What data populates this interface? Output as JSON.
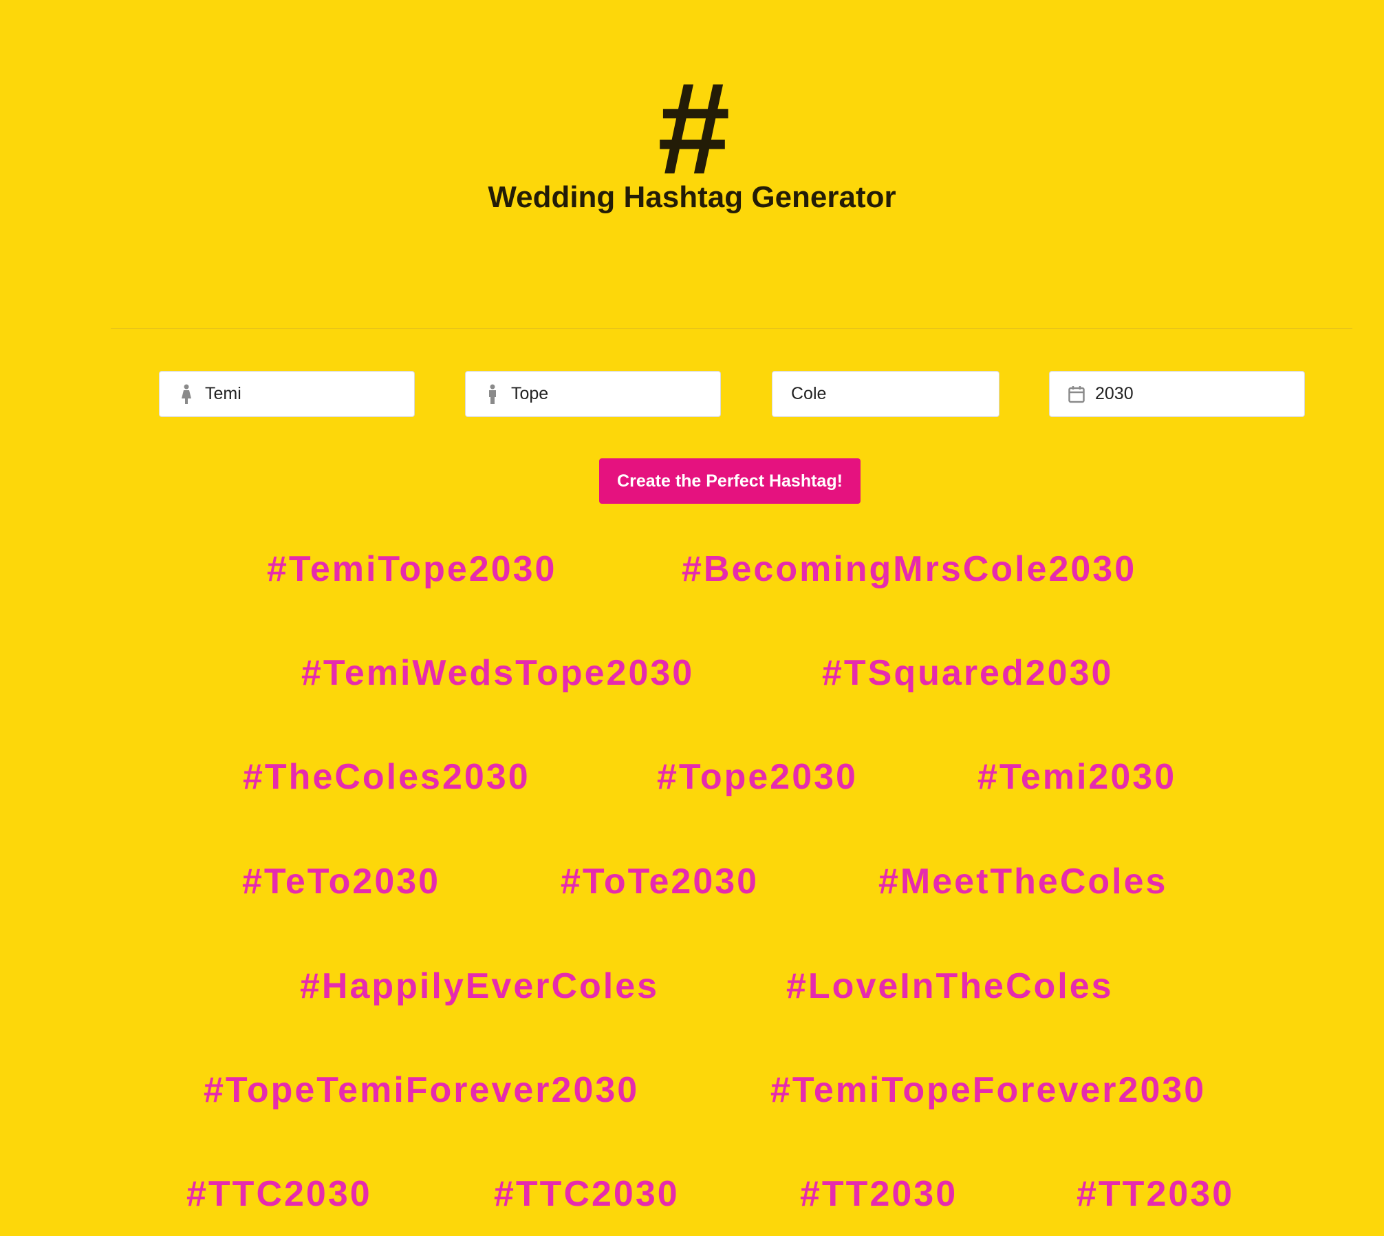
{
  "header": {
    "logo_glyph": "#",
    "title": "Wedding Hashtag Generator"
  },
  "form": {
    "first_name": {
      "value": "Temi",
      "icon": "female-person-icon"
    },
    "second_name": {
      "value": "Tope",
      "icon": "male-person-icon"
    },
    "last_name": {
      "value": "Cole"
    },
    "year": {
      "value": "2030",
      "icon": "calendar-icon"
    },
    "submit_label": "Create the Perfect Hashtag!"
  },
  "hashtags": [
    "#TemiTope2030",
    "#BecomingMrsCole2030",
    "#TemiWedsTope2030",
    "#TSquared2030",
    "#TheColes2030",
    "#Tope2030",
    "#Temi2030",
    "#TeTo2030",
    "#ToTe2030",
    "#MeetTheColes",
    "#HappilyEverColes",
    "#LoveInTheColes",
    "#TopeTemiForever2030",
    "#TemiTopeForever2030",
    "#TTC2030",
    "#TTC2030",
    "#TT2030",
    "#TT2030"
  ],
  "colors": {
    "background": "#FDD70A",
    "accent": "#E5127F",
    "hashtag": "#E62BAE",
    "title": "#231C07"
  }
}
